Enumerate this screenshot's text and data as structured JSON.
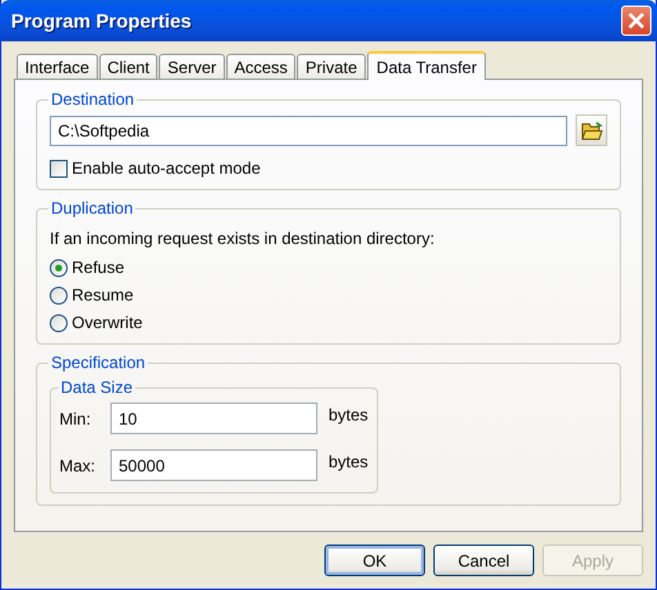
{
  "window": {
    "title": "Program Properties"
  },
  "tabs": [
    {
      "label": "Interface",
      "selected": false
    },
    {
      "label": "Client",
      "selected": false
    },
    {
      "label": "Server",
      "selected": false
    },
    {
      "label": "Access",
      "selected": false
    },
    {
      "label": "Private",
      "selected": false
    },
    {
      "label": "Data Transfer",
      "selected": true
    }
  ],
  "destination": {
    "legend": "Destination",
    "path": "C:\\Softpedia",
    "auto_accept": {
      "label": "Enable auto-accept mode",
      "checked": false
    }
  },
  "duplication": {
    "legend": "Duplication",
    "prompt": "If an incoming request exists in destination directory:",
    "options": [
      {
        "label": "Refuse",
        "selected": true
      },
      {
        "label": "Resume",
        "selected": false
      },
      {
        "label": "Overwrite",
        "selected": false
      }
    ]
  },
  "specification": {
    "legend": "Specification",
    "data_size": {
      "legend": "Data Size",
      "rows": [
        {
          "label": "Min:",
          "value": "10",
          "unit": "bytes"
        },
        {
          "label": "Max:",
          "value": "50000",
          "unit": "bytes"
        }
      ]
    }
  },
  "buttons": [
    {
      "label": "OK",
      "default": true,
      "disabled": false
    },
    {
      "label": "Cancel",
      "default": false,
      "disabled": false
    },
    {
      "label": "Apply",
      "default": false,
      "disabled": true
    }
  ]
}
